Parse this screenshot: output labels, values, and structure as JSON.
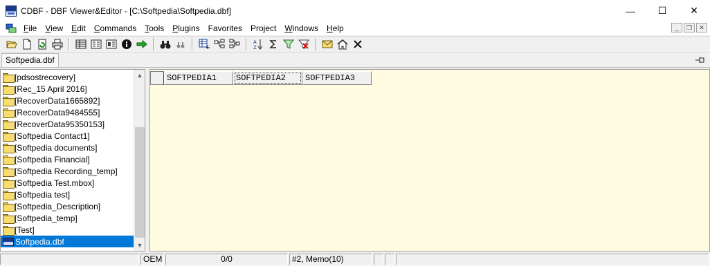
{
  "window": {
    "title": "CDBF - DBF Viewer&Editor - [C:\\Softpedia\\Softpedia.dbf]",
    "minimize": "—",
    "maximize": "☐",
    "close": "✕"
  },
  "menu": {
    "items": [
      {
        "accel": "F",
        "rest": "ile"
      },
      {
        "accel": "V",
        "rest": "iew"
      },
      {
        "accel": "E",
        "rest": "dit"
      },
      {
        "accel": "C",
        "rest": "ommands"
      },
      {
        "accel": "T",
        "rest": "ools"
      },
      {
        "accel": "P",
        "rest": "lugins"
      },
      {
        "accel": "",
        "rest": "Favorites"
      },
      {
        "accel": "",
        "rest": "Project"
      },
      {
        "accel": "W",
        "rest": "indows"
      },
      {
        "accel": "H",
        "rest": "elp"
      }
    ]
  },
  "mdi": {
    "minimize": "_",
    "restore": "❐",
    "close": "✕"
  },
  "toolbar": {
    "icons": [
      "open-folder-icon",
      "new-file-icon",
      "refresh-icon",
      "print-icon",
      "table-icon",
      "form-icon",
      "record-icon",
      "info-icon",
      "go-arrow-icon",
      "find-icon",
      "find-next-icon",
      "add-record-icon",
      "insert-field-icon",
      "delete-field-icon",
      "sort-az-icon",
      "sum-icon",
      "filter-icon",
      "clear-filter-icon",
      "mail-icon",
      "home-icon",
      "close-x-icon"
    ]
  },
  "tabs": {
    "active": "Softpedia.dbf"
  },
  "tree": {
    "items": [
      {
        "label": "[pdsostrecovery]",
        "type": "folder"
      },
      {
        "label": "[Rec_15 April 2016]",
        "type": "folder"
      },
      {
        "label": "[RecoverData1665892]",
        "type": "folder"
      },
      {
        "label": "[RecoverData9484555]",
        "type": "folder"
      },
      {
        "label": "[RecoverData95350153]",
        "type": "folder"
      },
      {
        "label": "[Softpedia Contact1]",
        "type": "folder"
      },
      {
        "label": "[Softpedia documents]",
        "type": "folder"
      },
      {
        "label": "[Softpedia Financial]",
        "type": "folder"
      },
      {
        "label": "[Softpedia Recording_temp]",
        "type": "folder"
      },
      {
        "label": "[Softpedia Test.mbox]",
        "type": "folder"
      },
      {
        "label": "[Softpedia test]",
        "type": "folder"
      },
      {
        "label": "[Softpedia_Description]",
        "type": "folder"
      },
      {
        "label": "[Softpedia_temp]",
        "type": "folder"
      },
      {
        "label": "[Test]",
        "type": "folder"
      },
      {
        "label": "Softpedia.dbf",
        "type": "dbf",
        "selected": true
      }
    ],
    "scroll_up": "▲",
    "scroll_down": "▼"
  },
  "grid": {
    "columns": [
      "SOFTPEDIA1",
      "SOFTPEDIA2",
      "SOFTPEDIA3"
    ],
    "active_column": 1
  },
  "status": {
    "codepage": "OEM",
    "record": "0/0",
    "field": "#2, Memo(10)"
  }
}
